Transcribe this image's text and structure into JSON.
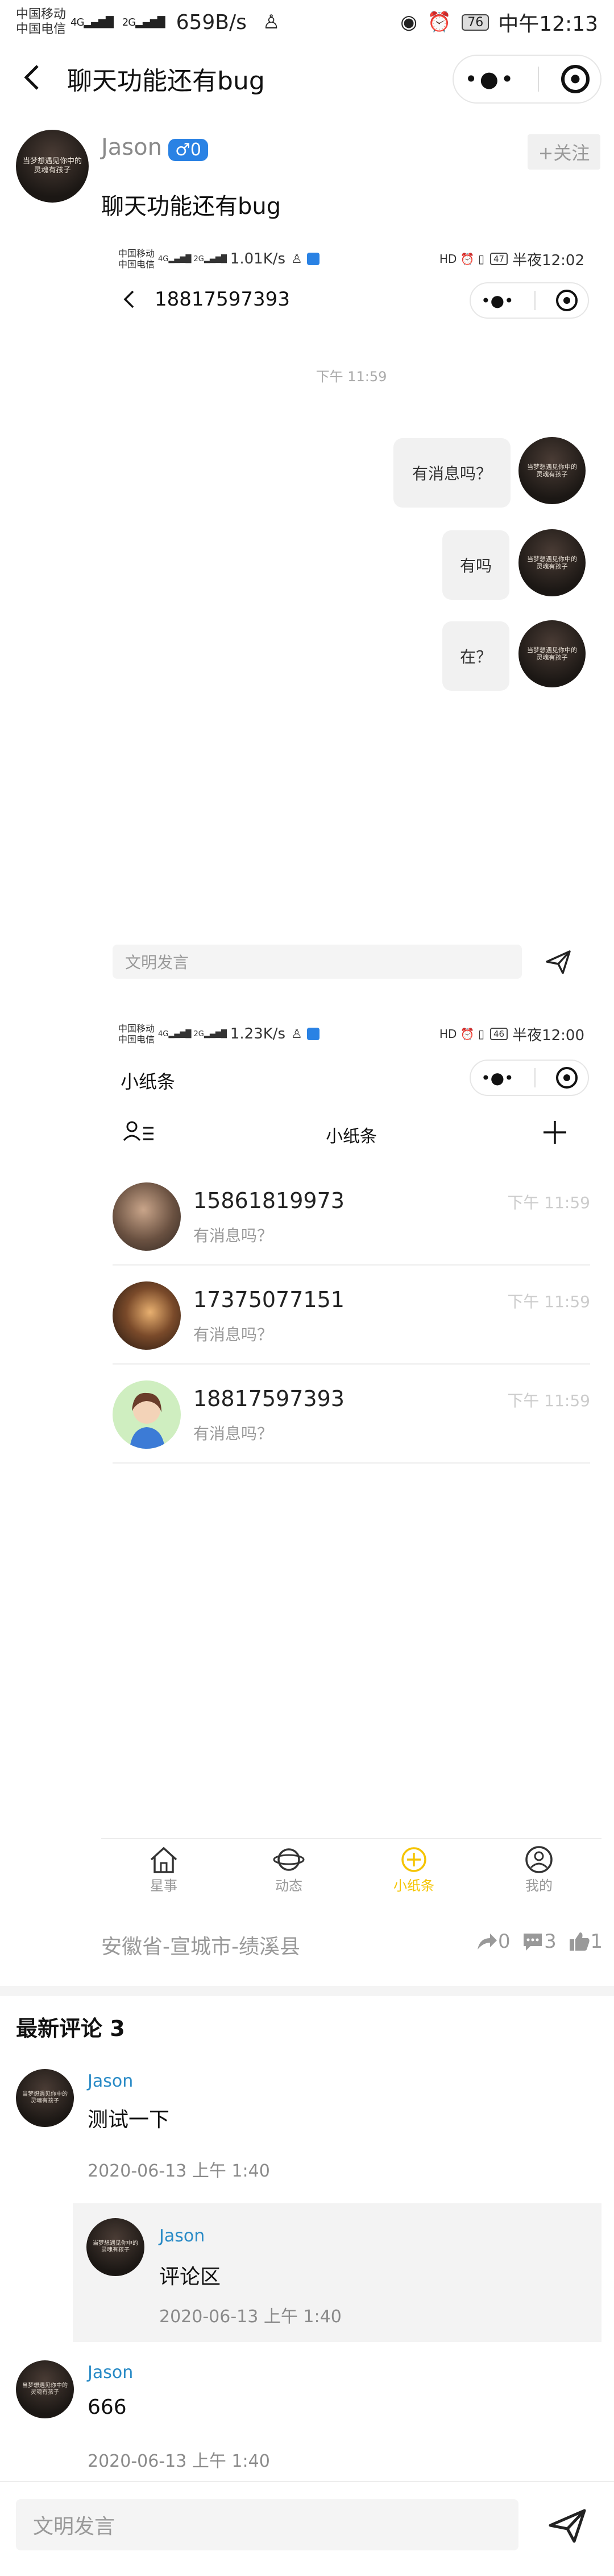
{
  "status_bar": {
    "carrier1": "中国移动",
    "carrier2": "中国电信",
    "net1": "4G",
    "net2": "2G",
    "speed": "659B/s",
    "battery": "76",
    "time": "中午12:13"
  },
  "nav": {
    "title": "聊天功能还有bug"
  },
  "post": {
    "author": "Jason",
    "gender_badge": "♂0",
    "follow_label": "+关注",
    "text": "聊天功能还有bug",
    "avatar_caption": "当梦想遇见你中的 灵魂有孩子"
  },
  "shot1": {
    "status": {
      "carrier1": "中国移动",
      "carrier2": "中国电信",
      "speed": "1.01K/s",
      "battery": "47",
      "time": "半夜12:02"
    },
    "title": "18817597393",
    "timestamp": "下午 11:59",
    "messages": [
      "有消息吗？",
      "有吗",
      "在？"
    ],
    "input_placeholder": "文明发言"
  },
  "shot2": {
    "status": {
      "carrier1": "中国移动",
      "carrier2": "中国电信",
      "speed": "1.23K/s",
      "battery": "46",
      "time": "半夜12:00"
    },
    "app_title": "小纸条",
    "tab_title": "小纸条",
    "conversations": [
      {
        "name": "15861819973",
        "preview": "有消息吗？",
        "time": "下午 11:59"
      },
      {
        "name": "17375077151",
        "preview": "有消息吗？",
        "time": "下午 11:59"
      },
      {
        "name": "18817597393",
        "preview": "有消息吗？",
        "time": "下午 11:59"
      }
    ],
    "tabs": [
      {
        "label": "星事",
        "icon": "home-icon"
      },
      {
        "label": "动态",
        "icon": "planet-icon"
      },
      {
        "label": "小纸条",
        "icon": "note-icon"
      },
      {
        "label": "我的",
        "icon": "user-icon"
      }
    ],
    "active_color": "#f5c400"
  },
  "location": "安徽省-宣城市-绩溪县",
  "stats": {
    "shares": "0",
    "comments": "3",
    "likes": "1"
  },
  "comments_header": "最新评论 3",
  "comments": [
    {
      "author": "Jason",
      "text": "测试一下",
      "time": "2020-06-13 上午 1:40"
    },
    {
      "author": "Jason",
      "text": "评论区",
      "time": "2020-06-13 上午 1:40"
    },
    {
      "author": "Jason",
      "text": "666",
      "time": "2020-06-13 上午 1:40"
    }
  ],
  "comment_input_placeholder": "文明发言",
  "colors": {
    "accent_blue": "#2a82e4",
    "link_blue": "#2a8bc6",
    "active_yellow": "#f5c400"
  }
}
